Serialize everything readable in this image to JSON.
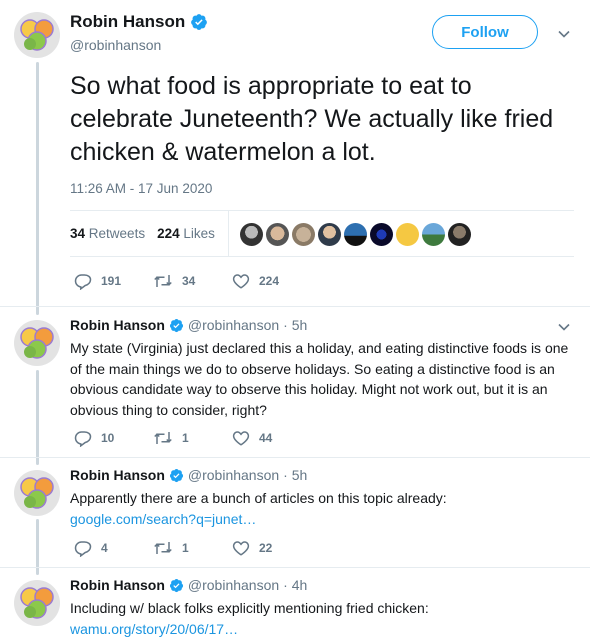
{
  "main_tweet": {
    "name": "Robin Hanson",
    "handle": "@robinhanson",
    "follow_label": "Follow",
    "text": "So what food is appropriate to eat to celebrate Juneteenth? We actually like fried chicken & watermelon a lot.",
    "timestamp": "11:26 AM - 17 Jun 2020",
    "retweets_count": "34",
    "retweets_label": "Retweets",
    "likes_count": "224",
    "likes_label": "Likes",
    "actions": {
      "replies": "191",
      "retweets": "34",
      "likes": "224"
    }
  },
  "replies": [
    {
      "name": "Robin Hanson",
      "handle": "@robinhanson",
      "age": "· 5h",
      "text": "My state (Virginia) just declared this a holiday, and eating distinctive foods is one of the main things we do to observe holidays. So eating a distinctive food is an obvious candidate way to observe this holiday. Might not work out, but it is an obvious thing to consider, right?",
      "link": "",
      "actions": {
        "replies": "10",
        "retweets": "1",
        "likes": "44"
      }
    },
    {
      "name": "Robin Hanson",
      "handle": "@robinhanson",
      "age": "· 5h",
      "text": "Apparently there are a bunch of articles on this topic already:",
      "link": "google.com/search?q=junet…",
      "actions": {
        "replies": "4",
        "retweets": "1",
        "likes": "22"
      }
    },
    {
      "name": "Robin Hanson",
      "handle": "@robinhanson",
      "age": "· 4h",
      "text": "Including w/ black folks explicitly mentioning fried chicken:",
      "link": "wamu.org/story/20/06/17…",
      "actions": {
        "replies": "",
        "retweets": "",
        "likes": ""
      }
    }
  ],
  "colors": {
    "accent": "#1da1f2",
    "link": "#1b95e0",
    "secondary_text": "#657786",
    "thread_line": "#ccd6dd"
  },
  "icons": [
    "verified-badge-icon",
    "chevron-down-icon",
    "reply-icon",
    "retweet-icon",
    "like-icon"
  ]
}
